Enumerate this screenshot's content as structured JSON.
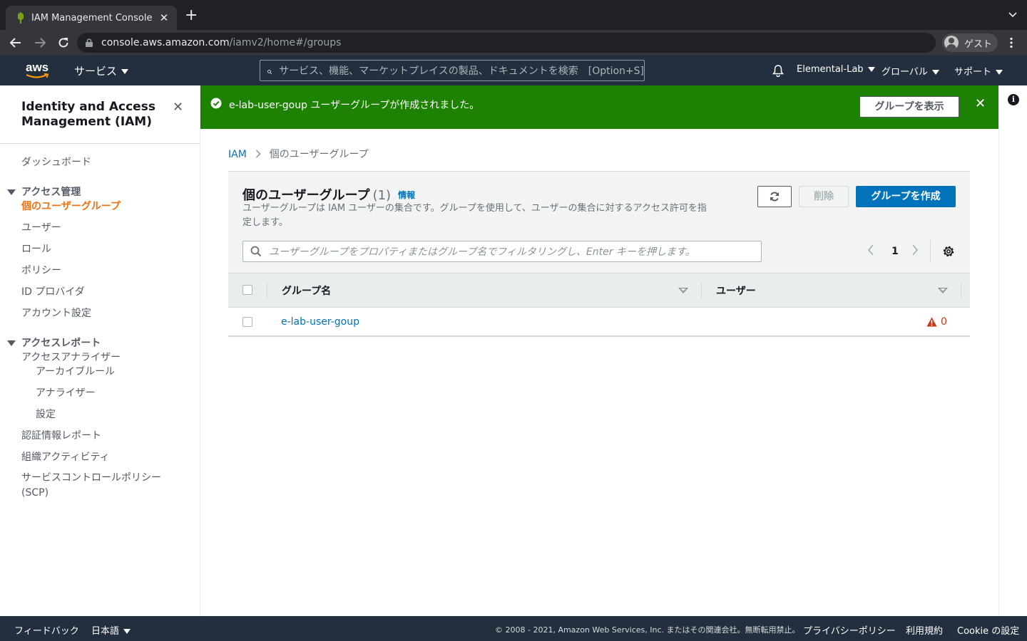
{
  "browser": {
    "tab_title": "IAM Management Console",
    "tab_close": "✕",
    "new_tab": "+",
    "url_host": "console.aws.amazon.com",
    "url_path": "/iamv2/home#/groups",
    "profile_label": "ゲスト"
  },
  "aws_nav": {
    "logo_text": "aws",
    "services_label": "サービス",
    "search_placeholder": "サービス、機能、マーケットプレイスの製品、ドキュメントを検索　[Option+S]",
    "account_label": "Elemental-Lab",
    "region_label": "グローバル",
    "support_label": "サポート"
  },
  "sidebar": {
    "title": "Identity and Access Management (IAM)",
    "close": "✕",
    "dashboard": "ダッシュボード",
    "access_mgmt_section": "アクセス管理",
    "access_mgmt_items": [
      "個のユーザーグループ",
      "ユーザー",
      "ロール",
      "ポリシー",
      "ID プロバイダ",
      "アカウント設定"
    ],
    "access_report_section": "アクセスレポート",
    "analyzer": "アクセスアナライザー",
    "analyzer_items": [
      "アーカイブルール",
      "アナライザー",
      "設定"
    ],
    "report_items": [
      "認証情報レポート",
      "組織アクティビティ",
      "サービスコントロールポリシー (SCP)"
    ]
  },
  "flash": {
    "message": "e-lab-user-goup ユーザーグループが作成されました。",
    "view_button": "グループを表示",
    "close": "✕",
    "color": "#1d8102"
  },
  "breadcrumb": {
    "root": "IAM",
    "current": "個のユーザーグループ"
  },
  "panel": {
    "title": "個のユーザーグループ",
    "count": "(1)",
    "info_link": "情報",
    "description": "ユーザーグループは IAM ユーザーの集合です。グループを使用して、ユーザーの集合に対するアクセス許可を指定します。",
    "delete_button": "削除",
    "create_button": "グループを作成",
    "filter_placeholder": "ユーザーグループをプロパティまたはグループ名でフィルタリングし、Enter キーを押します。",
    "page_number": "1",
    "columns": [
      "グループ名",
      "ユーザー"
    ],
    "rows": [
      {
        "group_name": "e-lab-user-goup",
        "users": "0"
      }
    ]
  },
  "footer": {
    "feedback": "フィードバック",
    "language": "日本語",
    "copyright": "© 2008 - 2021, Amazon Web Services, Inc. またはその関連会社。無断転用禁止。",
    "privacy": "プライバシーポリシー",
    "terms": "利用規約",
    "cookie": "Cookie の設定"
  },
  "colors": {
    "aws_nav": "#232f3e",
    "accent_orange": "#ec7211",
    "link_blue": "#0073bb",
    "warning_red": "#d13212"
  }
}
